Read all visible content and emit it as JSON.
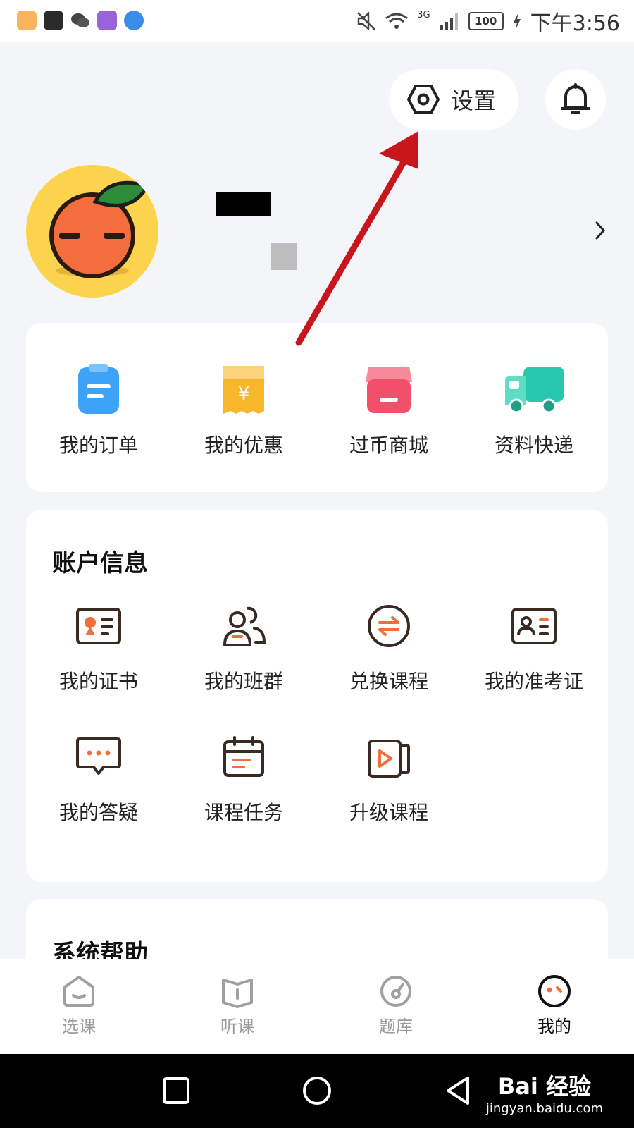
{
  "status_bar": {
    "time": "下午3:56",
    "battery": "100",
    "network": "3G",
    "app_icons": [
      "notes-app-icon",
      "huawei-appgallery-icon",
      "wechat-icon",
      "browser-icon",
      "weather-icon"
    ]
  },
  "header": {
    "settings_label": "设置",
    "settings_icon": "hexagon-gear-icon",
    "notification_icon": "bell-icon"
  },
  "profile": {
    "avatar_icon": "orange-mascot-avatar",
    "name": "[redacted]"
  },
  "quick_actions": [
    {
      "label": "我的订单",
      "icon": "order-clipboard-icon",
      "color": "#3ea2f7"
    },
    {
      "label": "我的优惠",
      "icon": "coupon-receipt-icon",
      "color": "#f8b62b"
    },
    {
      "label": "过币商城",
      "icon": "store-icon",
      "color": "#f2506a"
    },
    {
      "label": "资料快递",
      "icon": "delivery-truck-icon",
      "color": "#27c8ad"
    }
  ],
  "account_section": {
    "title": "账户信息",
    "items": [
      {
        "label": "我的证书",
        "icon": "certificate-icon"
      },
      {
        "label": "我的班群",
        "icon": "group-users-icon"
      },
      {
        "label": "兑换课程",
        "icon": "exchange-icon"
      },
      {
        "label": "我的准考证",
        "icon": "id-card-icon"
      },
      {
        "label": "我的答疑",
        "icon": "chat-bubble-icon"
      },
      {
        "label": "课程任务",
        "icon": "calendar-icon"
      },
      {
        "label": "升级课程",
        "icon": "video-play-icon"
      }
    ]
  },
  "help_section": {
    "title": "系统帮助"
  },
  "tab_bar": {
    "tabs": [
      {
        "label": "选课",
        "icon": "select-course-icon",
        "active": false
      },
      {
        "label": "听课",
        "icon": "listen-course-icon",
        "active": false
      },
      {
        "label": "题库",
        "icon": "question-bank-icon",
        "active": false
      },
      {
        "label": "我的",
        "icon": "my-profile-icon",
        "active": true
      }
    ]
  },
  "watermark": {
    "main": "Bai 经验",
    "sub": "jingyan.baidu.com"
  },
  "colors": {
    "accent_orange": "#f36d3d",
    "icon_dark": "#3a2a24",
    "annotation_red": "#c8161d"
  }
}
